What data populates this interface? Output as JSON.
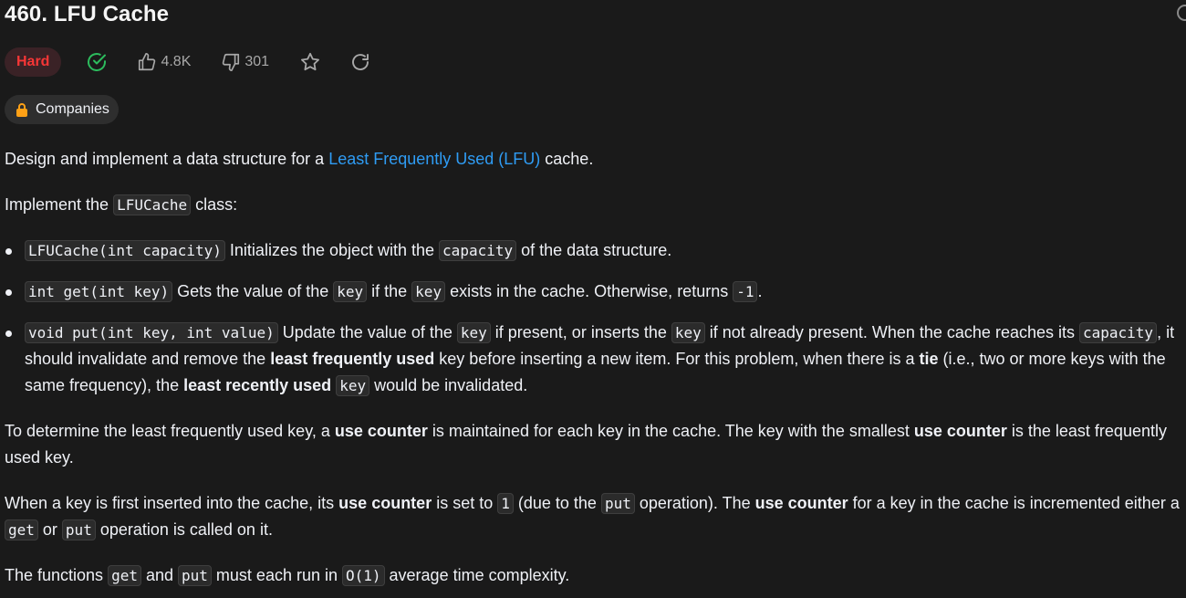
{
  "problem": {
    "title": "460. LFU Cache",
    "difficulty": "Hard",
    "likes": "4.8K",
    "dislikes": "301",
    "companies_label": "Companies"
  },
  "colors": {
    "background": "#1a1a1a",
    "hard": "#f63636",
    "solved": "#2cbb5d",
    "link": "#2f9cf4",
    "lock": "#ffa116"
  },
  "icons": [
    "check-circle-icon",
    "thumbs-up-icon",
    "thumbs-down-icon",
    "star-icon",
    "share-icon",
    "lock-icon"
  ],
  "description": {
    "intro_prefix": "Design and implement a data structure for a ",
    "intro_link": "Least Frequently Used (LFU)",
    "intro_suffix": " cache.",
    "implement_prefix": "Implement the ",
    "implement_code": "LFUCache",
    "implement_suffix": " class:",
    "bullet1": {
      "code": "LFUCache(int capacity)",
      "t1": " Initializes the object with the ",
      "code2": "capacity",
      "t2": " of the data structure."
    },
    "bullet2": {
      "code": "int get(int key)",
      "t1": " Gets the value of the ",
      "code2": "key",
      "t2": " if the ",
      "code3": "key",
      "t3": " exists in the cache. Otherwise, returns ",
      "code4": "-1",
      "t4": "."
    },
    "bullet3": {
      "code": "void put(int key, int value)",
      "t1": " Update the value of the ",
      "code2": "key",
      "t2": " if present, or inserts the ",
      "code3": "key",
      "t3": " if not already present. When the cache reaches its ",
      "code4": "capacity",
      "t4": ", it should invalidate and remove the ",
      "b1": "least frequently used",
      "t5": " key before inserting a new item. For this problem, when there is a ",
      "b2": "tie",
      "t6": " (i.e., two or more keys with the same frequency), the ",
      "b3": "least recently used",
      "t7": " ",
      "code5": "key",
      "t8": " would be invalidated."
    },
    "para3": {
      "t1": "To determine the least frequently used key, a ",
      "b1": "use counter",
      "t2": " is maintained for each key in the cache. The key with the smallest ",
      "b2": "use counter",
      "t3": " is the least frequently used key."
    },
    "para4": {
      "t1": "When a key is first inserted into the cache, its ",
      "b1": "use counter",
      "t2": " is set to ",
      "code1": "1",
      "t3": " (due to the ",
      "code2": "put",
      "t4": " operation). The ",
      "b2": "use counter",
      "t5": " for a key in the cache is incremented either a ",
      "code3": "get",
      "t6": " or ",
      "code4": "put",
      "t7": " operation is called on it."
    },
    "para5": {
      "t1": "The functions ",
      "code1": "get",
      "t2": " and ",
      "code2": "put",
      "t3": " must each run in ",
      "code3": "O(1)",
      "t4": " average time complexity."
    }
  }
}
